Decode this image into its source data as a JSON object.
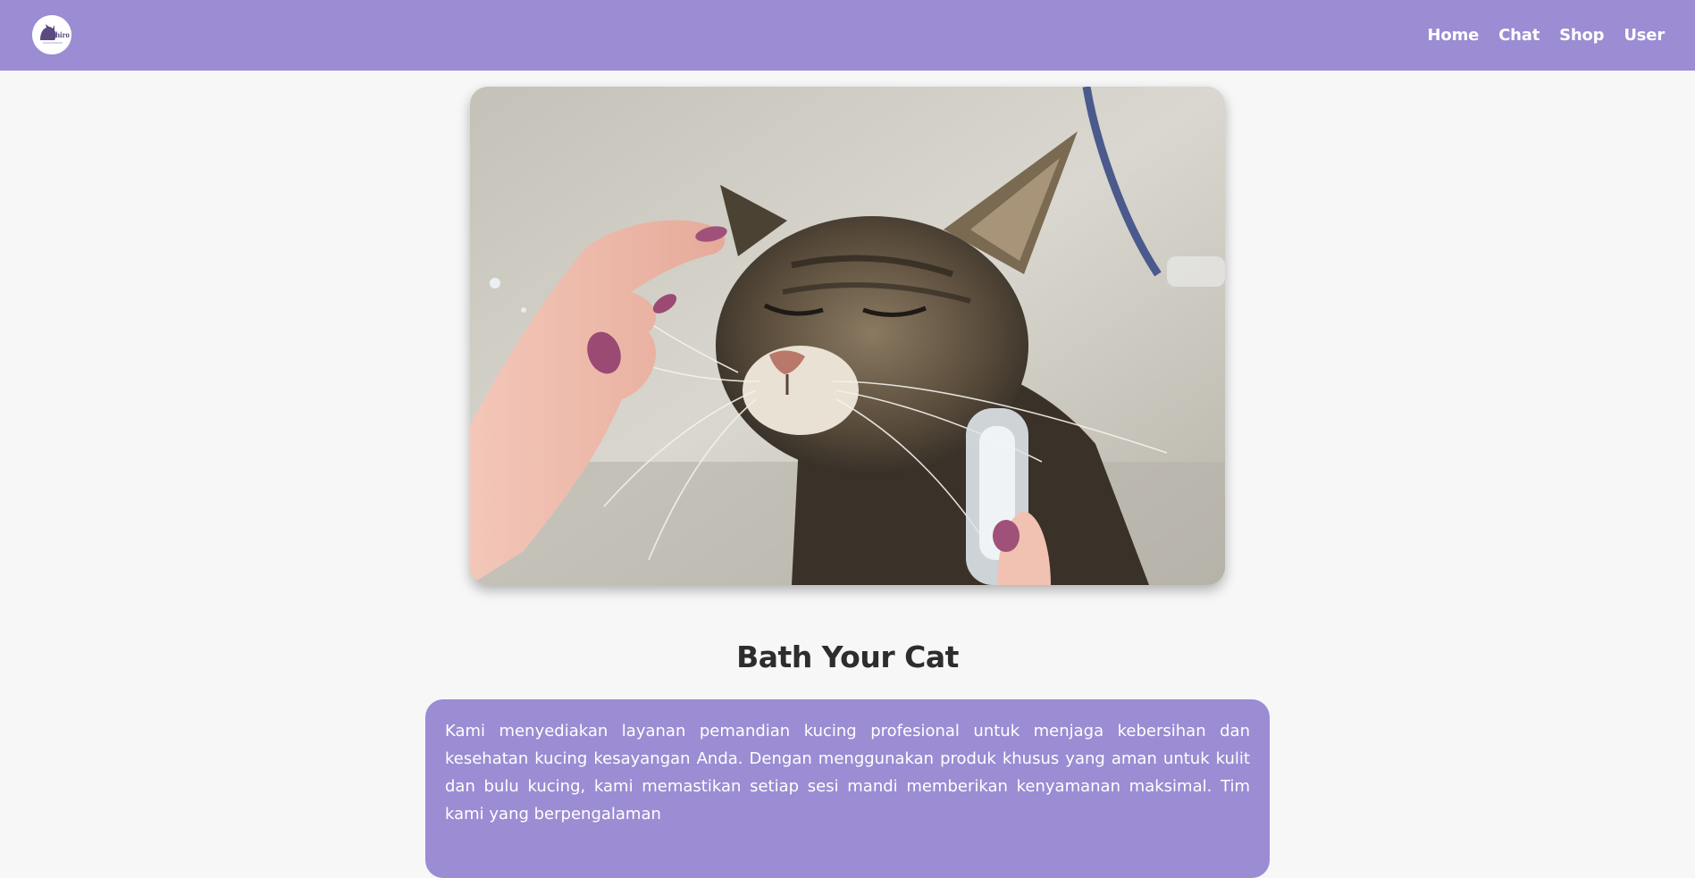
{
  "nav": {
    "logo_text": "Shiro",
    "links": [
      "Home",
      "Chat",
      "Shop",
      "User"
    ]
  },
  "hero": {
    "image_subject": "wet-cat-bath-photo"
  },
  "content": {
    "title": "Bath Your Cat",
    "description": "Kami menyediakan layanan pemandian kucing profesional untuk menjaga kebersihan dan kesehatan kucing kesayangan Anda. Dengan menggunakan produk khusus yang aman untuk kulit dan bulu kucing, kami memastikan setiap sesi mandi memberikan kenyamanan maksimal. Tim kami yang berpengalaman"
  },
  "colors": {
    "accent": "#9b8cd3",
    "background": "#f7f7f7",
    "title_text": "#2d2d2d",
    "card_text": "#ffffff"
  }
}
